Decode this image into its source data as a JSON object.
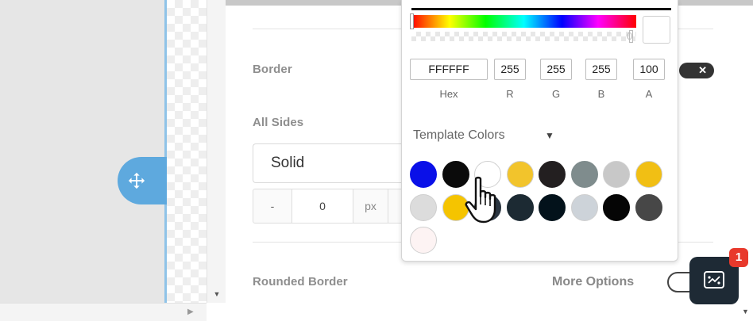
{
  "panel": {
    "border_label": "Border",
    "all_sides_label": "All Sides",
    "border_style_value": "Solid",
    "stepper_minus": "-",
    "border_width_value": "0",
    "border_width_unit": "px",
    "rounded_border_label": "Rounded Border",
    "more_options_label": "More Options",
    "toggle_close": "✕"
  },
  "chat": {
    "badge_count": "1"
  },
  "picker": {
    "alpha_readout": "0",
    "current_color": "#FFFFFF",
    "inputs": [
      {
        "label": "Hex",
        "value": "FFFFFF"
      },
      {
        "label": "R",
        "value": "255"
      },
      {
        "label": "G",
        "value": "255"
      },
      {
        "label": "B",
        "value": "255"
      },
      {
        "label": "A",
        "value": "100"
      }
    ],
    "template_colors_label": "Template Colors",
    "template_colors_caret": "▼",
    "template_colors": [
      "#0a10e8",
      "#0b0b0b",
      "#ffffff",
      "#f2c42c",
      "#231f20",
      "#7f8c8d",
      "#c8c8c8",
      "#f1bf14",
      "#dcdcdc",
      "#f5c400",
      "#2a3540",
      "#1c2a33",
      "#03121b",
      "#cdd3d9",
      "#050505",
      "#474747",
      "#fdf3f3"
    ]
  },
  "icons": {
    "move_handle": "move-arrows-icon",
    "chat": "chat-widget-icon",
    "cursor": "hand-pointer-icon"
  }
}
